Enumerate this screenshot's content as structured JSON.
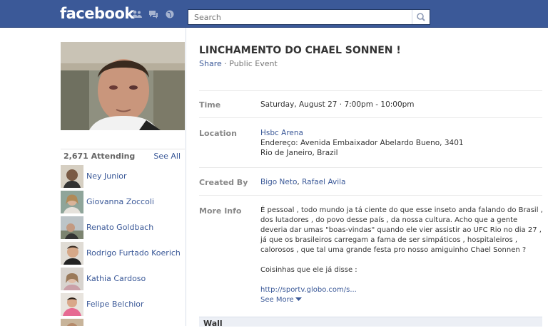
{
  "topbar": {
    "logo": "facebook",
    "search_placeholder": "Search"
  },
  "sidebar": {
    "attending_count": "2,671 Attending",
    "see_all": "See All",
    "attendees": [
      {
        "name": "Ney Junior"
      },
      {
        "name": "Giovanna Zoccoli"
      },
      {
        "name": "Renato Goldbach"
      },
      {
        "name": "Rodrigo Furtado Koerich"
      },
      {
        "name": "Kathia Cardoso"
      },
      {
        "name": "Felipe Belchior"
      }
    ]
  },
  "event": {
    "title": "LINCHAMENTO DO CHAEL SONNEN !",
    "share": "Share",
    "separator": "·",
    "visibility": "Public Event",
    "time_label": "Time",
    "time_value": "Saturday, August 27 · 7:00pm - 10:00pm",
    "location_label": "Location",
    "location_name": "Hsbc Arena",
    "location_line2": "Endereço: Avenida Embaixador Abelardo Bueno, 3401",
    "location_line3": "Rio de Janeiro, Brazil",
    "created_by_label": "Created By",
    "creator_1": "Bigo Neto",
    "creator_sep": ", ",
    "creator_2": "Rafael Avila",
    "more_info_label": "More Info",
    "more_info_text": "É pessoal , todo mundo ja tá ciente do que esse inseto anda falando do Brasil , dos lutadores , do povo desse país , da nossa cultura. Acho que a gente deveria dar umas \"boas-vindas\" quando ele vier assistir ao UFC Rio no dia 27 , já que os brasileiros carregam a fama de ser simpáticos , hospitaleiros , calorosos , que tal uma grande festa pro nosso amiguinho Chael Sonnen ?",
    "more_info_text2": "Coisinhas que ele já disse :",
    "link": "http://sportv.globo.com/s...",
    "see_more": "See More",
    "wall_label": "Wall"
  },
  "colors": {
    "brand": "#3b5998",
    "link": "#3b5998"
  }
}
